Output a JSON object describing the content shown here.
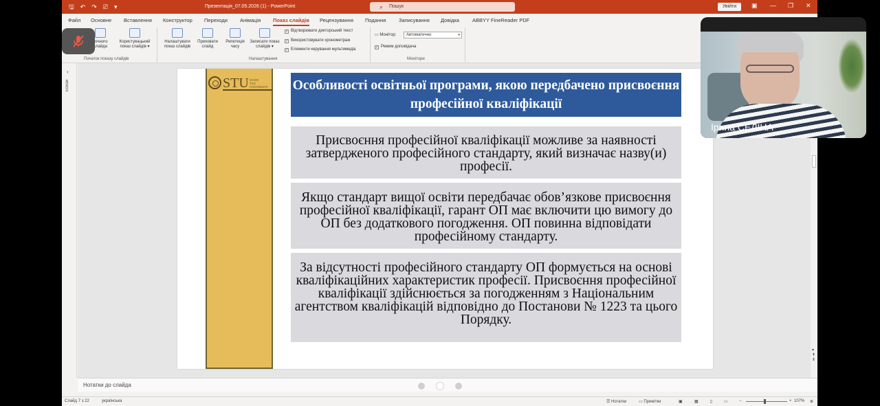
{
  "app": {
    "doc_title": "Презентація_07.05.2026 (1)  -  PowerPoint",
    "search_placeholder": "Пошук",
    "signin_label": "Увійти",
    "accent_color": "#c43e1c"
  },
  "menu_tabs": [
    "Файл",
    "Основне",
    "Вставлення",
    "Конструктор",
    "Переходи",
    "Анімація",
    "Показ слайдів",
    "Рецензування",
    "Подання",
    "Записування",
    "Довідка",
    "ABBYY FineReader PDF"
  ],
  "active_tab": "Показ слайдів",
  "ribbon": {
    "from_current": "точного\nслайда",
    "custom_show": "Користувацький\nпоказ слайдів ▾",
    "setup_show": "Налаштувати\nпоказ слайдів",
    "hide_slide": "Приховати\nслайд",
    "rehearse": "Репетиція\nчасу",
    "record_show": "Записати показ\nслайдів ▾",
    "check_narrations": "Відтворювати дикторський текст",
    "check_timings": "Використовувати хронометраж",
    "check_media": "Елементи керування мультимедіа",
    "monitor_label": "Монітор:",
    "monitor_value": "Автоматично",
    "presenter_view": "Режим доповідача",
    "group_start": "Початок показу слайдів",
    "group_setup": "Налаштування",
    "group_monitors": "Монітори"
  },
  "thumb_pane": {
    "label": "Ескізи"
  },
  "slide": {
    "logo_text": "STU",
    "logo_sub": "STATE\nTAX\nUNIVERSITY",
    "title": "Особливості освітньої програми, якою передбачено присвоєння професійної кваліфікації",
    "box1": "Присвоєння професійної кваліфікації можливе за наявності затвердженого професійного стандарту, який визначає назву(и) професії.",
    "box2": "Якщо стандарт вищої освіти передбачає обов’язкове присвоєння професійної кваліфікації, гарант ОП має включити цю вимогу до ОП без додаткового погодження. ОП повинна відповідати професійному стандарту.",
    "box3": "За відсутності професійного стандарту ОП формується на основі кваліфікаційних характеристик професії. Присвоєння професійної кваліфікації здійснюється за погодженням з Національним агентством кваліфікацій відповідно до Постанови № 1223 та цього Порядку.",
    "band_color": "#e6bc5a",
    "title_color": "#2e5a9c"
  },
  "notes": {
    "label": "Нотатки до слайда"
  },
  "status": {
    "slide_info": "Слайд 7 з 22",
    "language": "українська",
    "notes_btn": "Нотатки",
    "comments_btn": "Примітки",
    "zoom": "107%"
  },
  "meeting": {
    "participant_name": "Ірина СЕЛІНА",
    "page_dots": 3,
    "active_dot": 2
  }
}
